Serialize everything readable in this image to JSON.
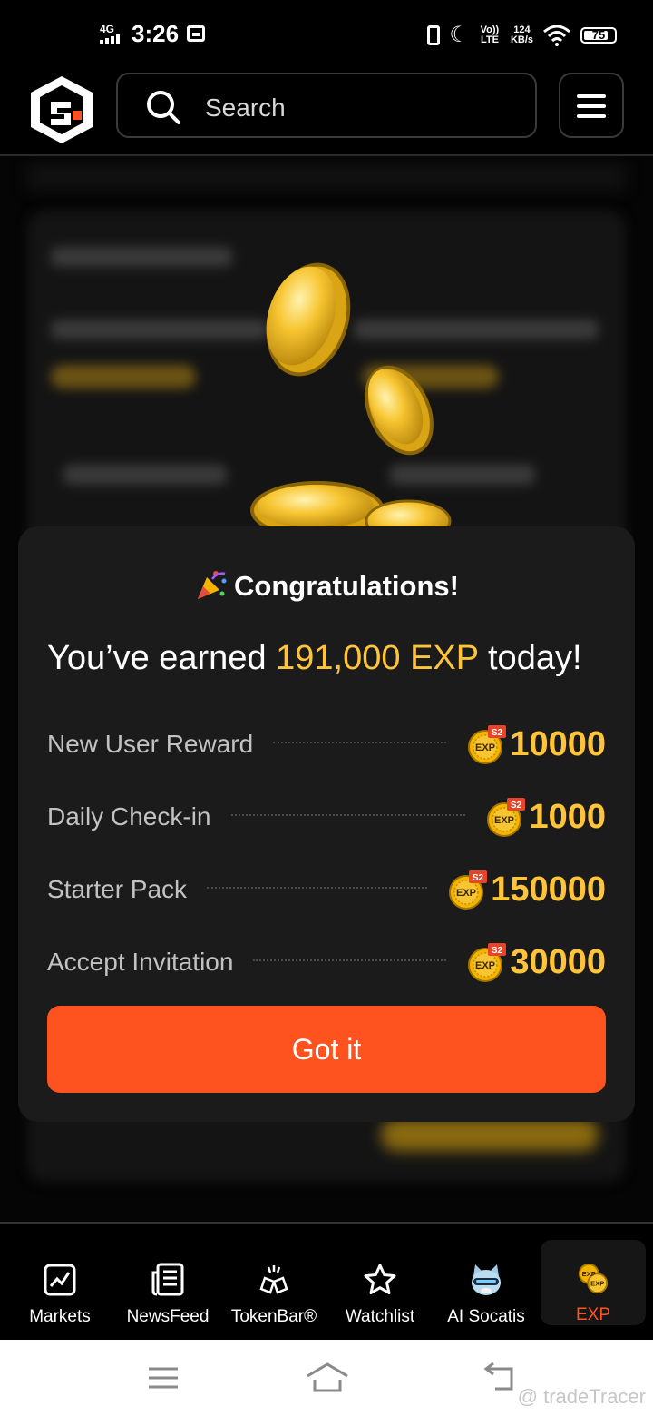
{
  "status_bar": {
    "network": "4G",
    "time": "3:26",
    "volte": "Vo)) LTE",
    "speed_value": "124",
    "speed_unit": "KB/s",
    "battery": "75"
  },
  "header": {
    "search_placeholder": "Search"
  },
  "modal": {
    "title": "Congratulations!",
    "earned_prefix": "You’ve earned",
    "earned_amount": "191,000 EXP",
    "earned_suffix": "today!",
    "badge_season": "S2",
    "badge_text": "EXP",
    "rewards": [
      {
        "label": "New User Reward",
        "value": "10000"
      },
      {
        "label": "Daily Check-in",
        "value": "1000"
      },
      {
        "label": "Starter Pack",
        "value": "150000"
      },
      {
        "label": "Accept Invitation",
        "value": "30000"
      }
    ],
    "button_label": "Got it"
  },
  "bottom_nav": {
    "items": [
      {
        "label": "Markets",
        "icon": "chart-icon"
      },
      {
        "label": "NewsFeed",
        "icon": "newspaper-icon"
      },
      {
        "label": "TokenBar®",
        "icon": "tokenbar-icon"
      },
      {
        "label": "Watchlist",
        "icon": "star-icon"
      },
      {
        "label": "AI Socatis",
        "icon": "cat-avatar-icon"
      },
      {
        "label": "EXP",
        "icon": "exp-coins-icon"
      }
    ],
    "active": "EXP"
  },
  "watermark": "@ tradeTracer",
  "colors": {
    "accent": "#ff531f",
    "gold": "#ffc43a",
    "modal_bg": "#1b1b1b"
  }
}
